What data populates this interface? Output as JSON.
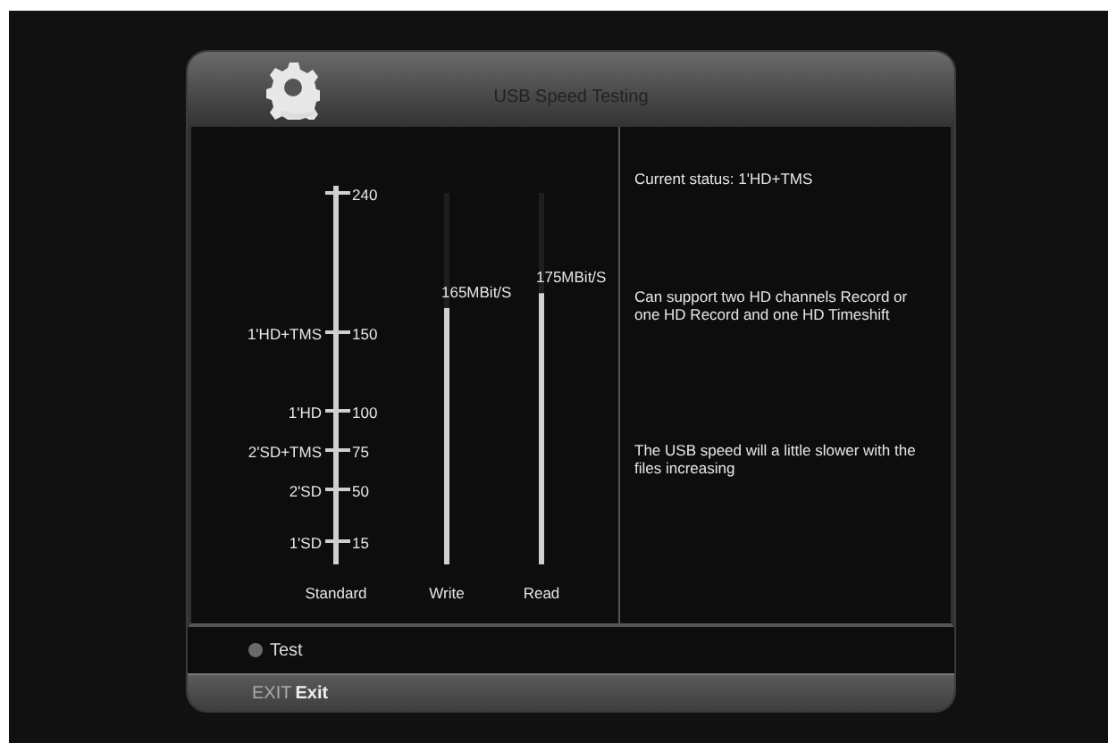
{
  "window": {
    "title": "USB Speed Testing"
  },
  "scale": {
    "title": "Standard",
    "ticks": [
      {
        "value": "240"
      },
      {
        "value": "150",
        "label": "1'HD+TMS"
      },
      {
        "value": "100",
        "label": "1'HD"
      },
      {
        "value": "75",
        "label": "2'SD+TMS"
      },
      {
        "value": "50",
        "label": "2'SD"
      },
      {
        "value": "15",
        "label": "1'SD"
      }
    ]
  },
  "meters": [
    {
      "label": "Write",
      "reading": "165MBit/S",
      "level": 0.69
    },
    {
      "label": "Read",
      "reading": "175MBit/S",
      "level": 0.73
    }
  ],
  "info": [
    "Current status: 1'HD+TMS",
    "Can support two HD channels Record or one HD Record and one HD Timeshift",
    "The USB speed will a little slower with the files increasing"
  ],
  "actions": [
    {
      "label": "Test",
      "color": "#6a6a6a"
    }
  ],
  "footer": {
    "key": "EXIT",
    "label": "Exit"
  }
}
